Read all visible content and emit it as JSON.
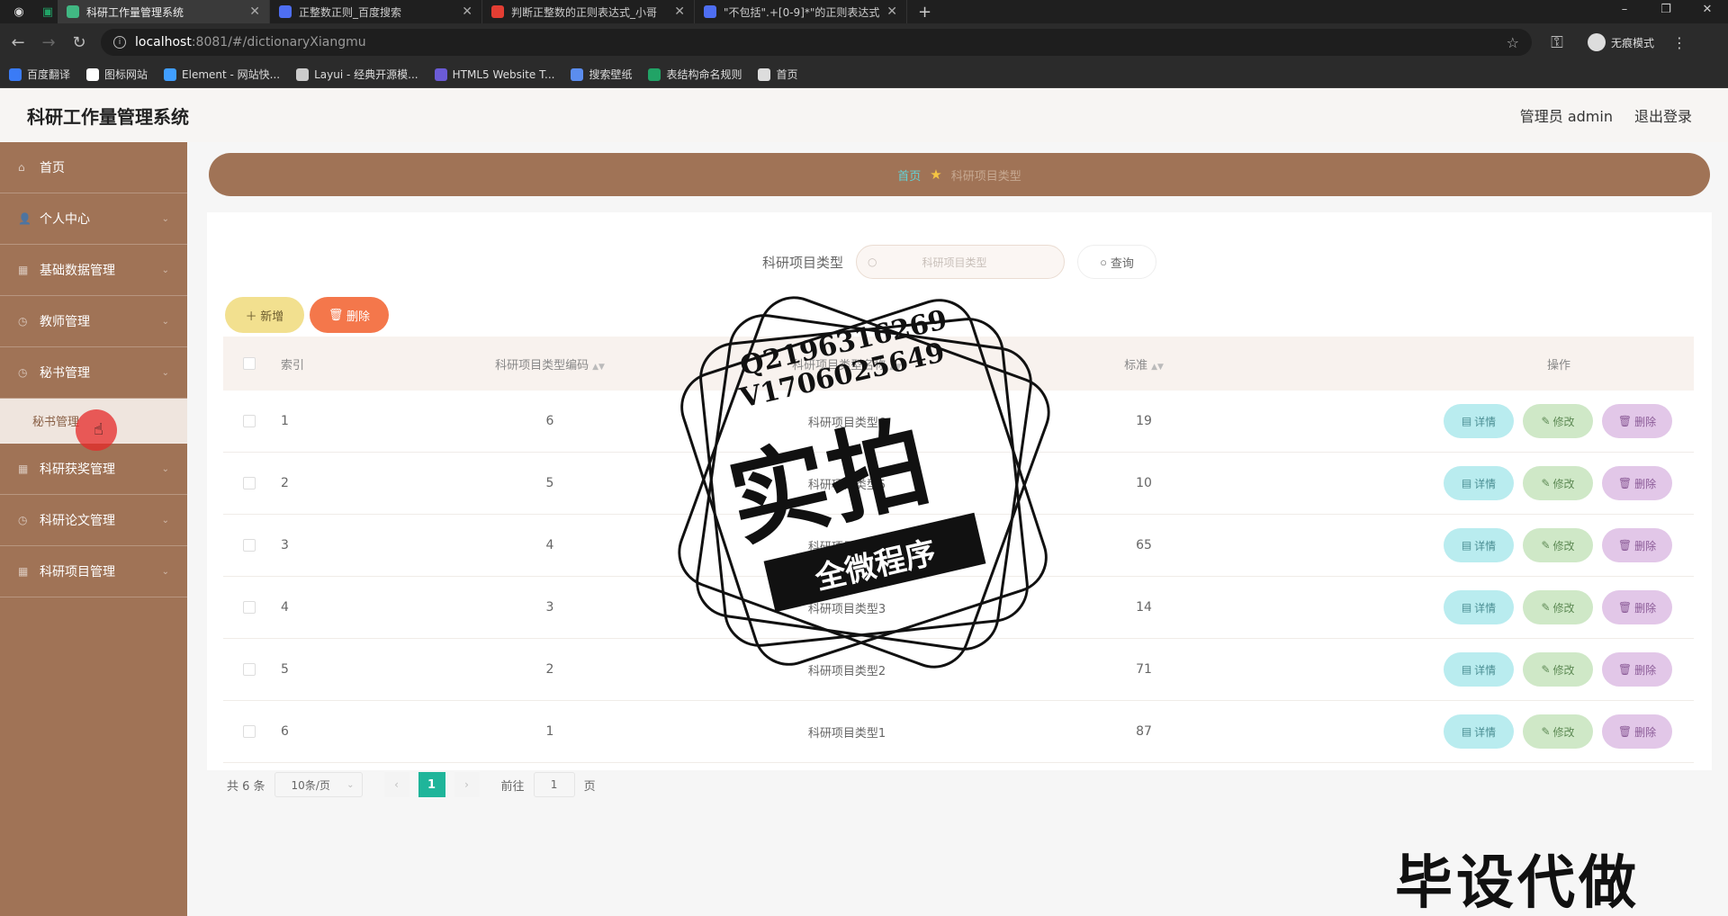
{
  "browser": {
    "tabs": [
      {
        "title": "科研工作量管理系统",
        "active": true,
        "favicon": "vue-icon",
        "favicon_color": "#41b883"
      },
      {
        "title": "正整数正则_百度搜索",
        "active": false,
        "favicon": "baidu-icon",
        "favicon_color": "#4e6ef2"
      },
      {
        "title": "判断正整数的正则表达式_小哥",
        "active": false,
        "favicon": "csdn-icon",
        "favicon_color": "#e33e33"
      },
      {
        "title": "\"不包括\".+[0-9]*\"的正则表达式",
        "active": false,
        "favicon": "baidu-icon",
        "favicon_color": "#4e6ef2"
      }
    ],
    "url_host": "localhost",
    "url_path": ":8081/#/dictionaryXiangmu",
    "profile_label": "无痕模式",
    "bookmarks": [
      {
        "label": "百度翻译",
        "color": "#3a7bf6"
      },
      {
        "label": "图标网站",
        "color": "#ffffff"
      },
      {
        "label": "Element - 网站快...",
        "color": "#409eff"
      },
      {
        "label": "Layui - 经典开源模...",
        "color": "#cccccc"
      },
      {
        "label": "HTML5 Website T...",
        "color": "#6b5bd6"
      },
      {
        "label": "搜索壁纸",
        "color": "#5b8def"
      },
      {
        "label": "表结构命名规则",
        "color": "#21a366"
      },
      {
        "label": "首页",
        "color": "#dddddd"
      }
    ]
  },
  "header": {
    "title": "科研工作量管理系统",
    "user": "管理员 admin",
    "logout": "退出登录"
  },
  "sidebar": {
    "items": [
      {
        "label": "首页",
        "icon": "home-icon"
      },
      {
        "label": "个人中心",
        "icon": "user-icon"
      },
      {
        "label": "基础数据管理",
        "icon": "grid-icon"
      },
      {
        "label": "教师管理",
        "icon": "clock-icon"
      },
      {
        "label": "秘书管理",
        "icon": "clock-icon"
      }
    ],
    "sub_item": "秘书管理",
    "items_after": [
      {
        "label": "科研获奖管理",
        "icon": "grid-icon"
      },
      {
        "label": "科研论文管理",
        "icon": "clock-icon"
      },
      {
        "label": "科研项目管理",
        "icon": "grid-icon"
      }
    ]
  },
  "breadcrumb": {
    "home": "首页",
    "current": "科研项目类型"
  },
  "search": {
    "label": "科研项目类型",
    "placeholder": "科研项目类型",
    "button": "查询"
  },
  "actions": {
    "add": "新增",
    "delete": "删除"
  },
  "table": {
    "headers": {
      "index": "索引",
      "code": "科研项目类型编码",
      "name": "科研项目类型名称",
      "standard": "标准",
      "operation": "操作"
    },
    "rows": [
      {
        "index": "1",
        "code": "6",
        "name": "科研项目类型6",
        "standard": "19"
      },
      {
        "index": "2",
        "code": "5",
        "name": "科研项目类型5",
        "standard": "10"
      },
      {
        "index": "3",
        "code": "4",
        "name": "科研项目类型4",
        "standard": "65"
      },
      {
        "index": "4",
        "code": "3",
        "name": "科研项目类型3",
        "standard": "14"
      },
      {
        "index": "5",
        "code": "2",
        "name": "科研项目类型2",
        "standard": "71"
      },
      {
        "index": "6",
        "code": "1",
        "name": "科研项目类型1",
        "standard": "87"
      }
    ],
    "op_detail": "详情",
    "op_edit": "修改",
    "op_delete": "删除"
  },
  "pagination": {
    "total": "共 6 条",
    "page_size": "10条/页",
    "current_page": "1",
    "goto_label": "前往",
    "goto_value": "1",
    "page_unit": "页"
  },
  "watermark": {
    "qq": "Q2196316269",
    "vx": "V1706025649",
    "big": "实拍",
    "banner": "全微程序",
    "corner": "毕设代做"
  },
  "colors": {
    "sidebar": "#a07356",
    "accent": "#1fb59a",
    "breadcrumb_home": "#63d1d6"
  }
}
